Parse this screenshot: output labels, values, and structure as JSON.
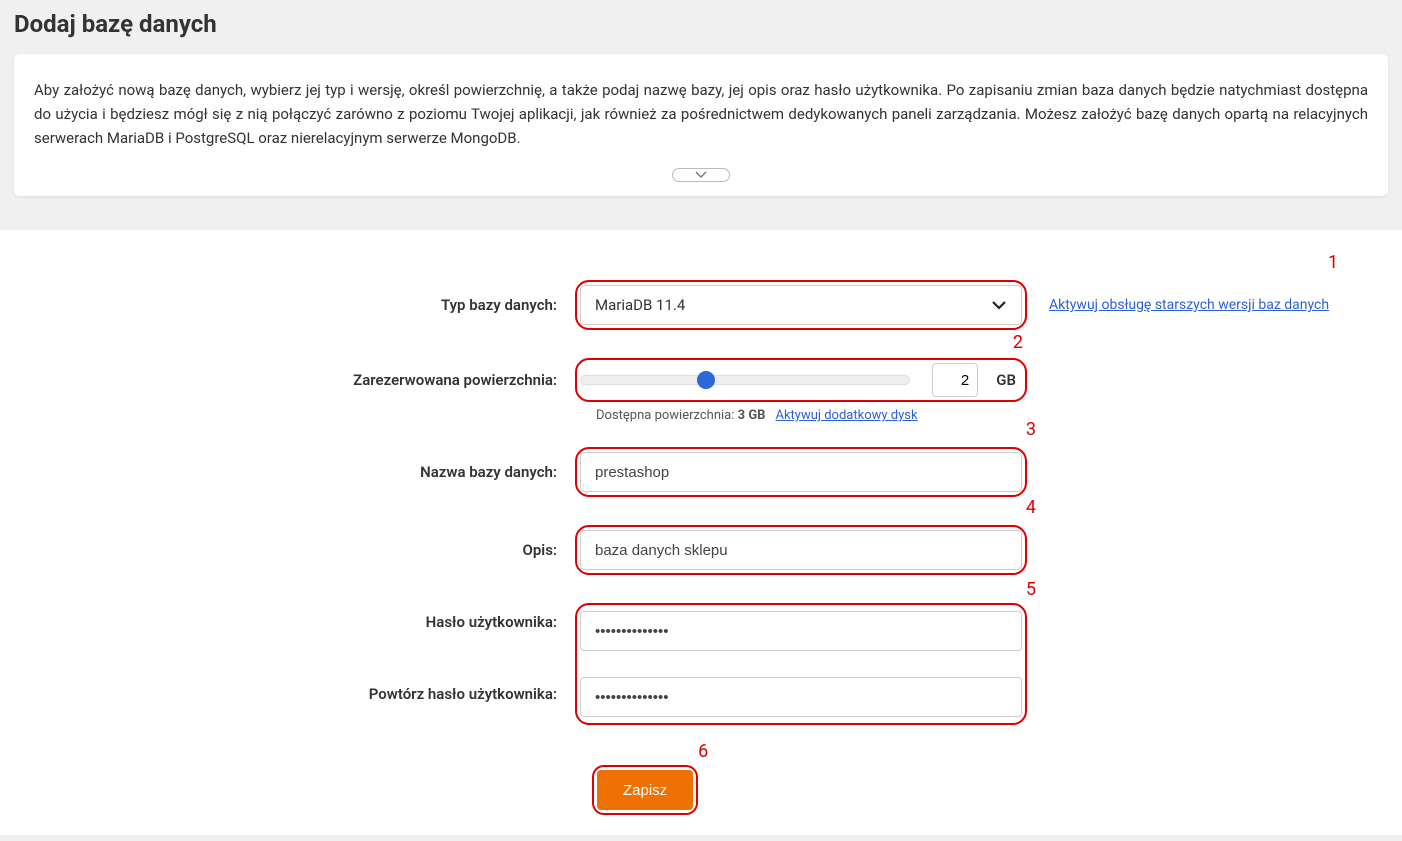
{
  "page_title": "Dodaj bazę danych",
  "info_text": "Aby założyć nową bazę danych, wybierz jej typ i wersję, określ powierzchnię, a także podaj nazwę bazy, jej opis oraz hasło użytkownika. Po zapisaniu zmian baza danych będzie natychmiast dostępna do użycia i będziesz mógł się z nią połączyć zarówno z poziomu Twojej aplikacji, jak również za pośrednictwem dedykowanych paneli zarządzania. Możesz założyć bazę danych opartą na relacyjnych serwerach MariaDB i PostgreSQL oraz nierelacyjnym serwerze MongoDB.",
  "annotations": {
    "1": "1",
    "2": "2",
    "3": "3",
    "4": "4",
    "5": "5",
    "6": "6"
  },
  "form": {
    "db_type": {
      "label": "Typ bazy danych:",
      "value": "MariaDB 11.4",
      "side_link": "Aktywuj obsługę starszych wersji baz danych"
    },
    "reserved_space": {
      "label": "Zarezerwowana powierzchnia:",
      "value": "2",
      "unit": "GB",
      "hint_prefix": "Dostępna powierzchnia: ",
      "hint_value": "3 GB",
      "hint_link": "Aktywuj dodatkowy dysk"
    },
    "db_name": {
      "label": "Nazwa bazy danych:",
      "value": "prestashop"
    },
    "description": {
      "label": "Opis:",
      "value": "baza danych sklepu"
    },
    "password": {
      "label": "Hasło użytkownika:",
      "value": "••••••••••••••"
    },
    "password_repeat": {
      "label": "Powtórz hasło użytkownika:",
      "value": "••••••••••••••"
    },
    "save_label": "Zapisz"
  }
}
